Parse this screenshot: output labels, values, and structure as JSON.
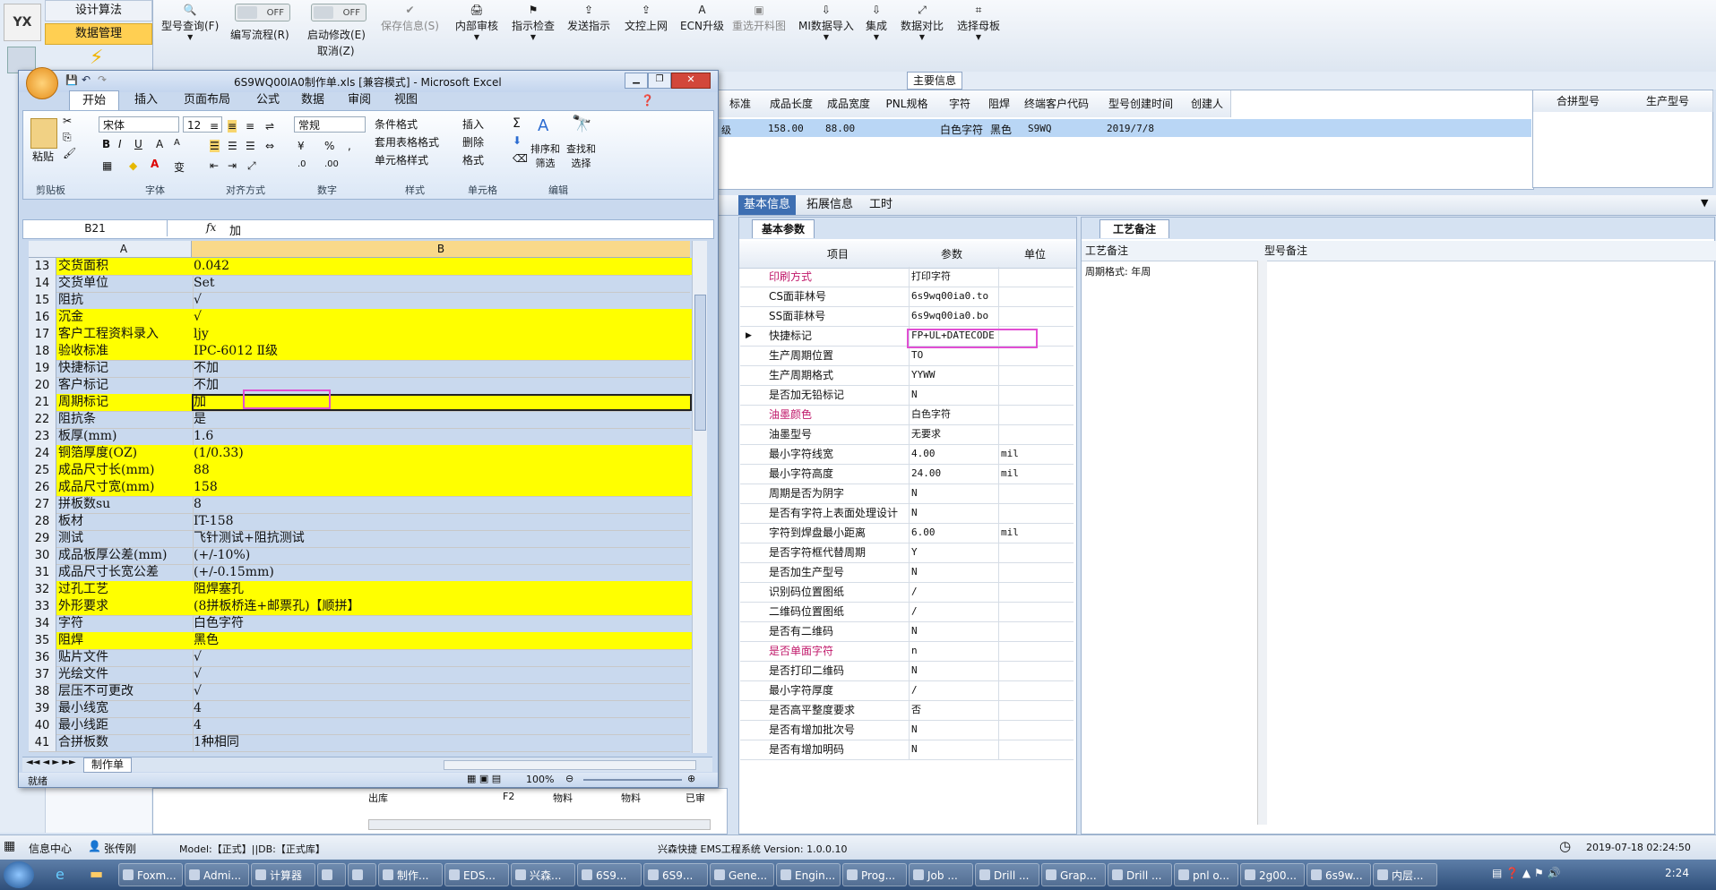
{
  "app": {
    "nav_tabs": [
      "设计算法",
      "数据管理"
    ],
    "toolbar": [
      {
        "label": "型号查询(F)",
        "icon": "search-icon",
        "disabled": false
      },
      {
        "label": "编写流程(R)",
        "icon": "toggle",
        "disabled": false
      },
      {
        "label": "启动修改(E)",
        "icon": "toggle",
        "disabled": false
      },
      {
        "label": "取消(Z)",
        "icon": "",
        "disabled": false
      },
      {
        "label": "保存信息(S)",
        "icon": "check-icon",
        "disabled": true
      },
      {
        "label": "内部审核",
        "icon": "print-icon",
        "disabled": false
      },
      {
        "label": "指示检查",
        "icon": "flag-icon",
        "disabled": false
      },
      {
        "label": "发送指示",
        "icon": "upload-icon",
        "disabled": false
      },
      {
        "label": "文控上网",
        "icon": "upload-icon",
        "disabled": false
      },
      {
        "label": "ECN升级",
        "icon": "letter-a-icon",
        "disabled": false
      },
      {
        "label": "重选开料图",
        "icon": "image-icon",
        "disabled": true
      },
      {
        "label": "MI数据导入",
        "icon": "download-icon",
        "disabled": false
      },
      {
        "label": "集成",
        "icon": "download-icon",
        "disabled": false
      },
      {
        "label": "数据对比",
        "icon": "compare-icon",
        "disabled": false
      },
      {
        "label": "选择母板",
        "icon": "grid-icon",
        "disabled": false
      }
    ],
    "toggle_off": "OFF",
    "main_info_title": "主要信息",
    "main_columns": [
      "标准",
      "成品长度",
      "成品宽度",
      "PNL规格",
      "字符",
      "阻焊",
      "终端客户代码",
      "型号创建时间",
      "创建人"
    ],
    "main_row": [
      "级",
      "158.00",
      "88.00",
      "",
      "白色字符",
      "黑色",
      "S9WQ",
      "2019/7/8",
      ""
    ],
    "right_columns": [
      "合拼型号",
      "生产型号"
    ],
    "detail_tabs": [
      "基本信息",
      "拓展信息",
      "工时"
    ],
    "basic_params_tab": "基本参数",
    "process_notes_tab": "工艺备注",
    "param_headers": [
      "项目",
      "参数",
      "单位"
    ],
    "params": [
      {
        "k": "印刷方式",
        "v": "打印字符",
        "u": "",
        "red": true
      },
      {
        "k": "CS面菲林号",
        "v": "6s9wq00ia0.to",
        "u": "",
        "red": false
      },
      {
        "k": "SS面菲林号",
        "v": "6s9wq00ia0.bo",
        "u": "",
        "red": false
      },
      {
        "k": "快捷标记",
        "v": "FP+UL+DATECODE",
        "u": "",
        "red": false
      },
      {
        "k": "生产周期位置",
        "v": "TO",
        "u": "",
        "red": false
      },
      {
        "k": "生产周期格式",
        "v": "YYWW",
        "u": "",
        "red": false
      },
      {
        "k": "是否加无铅标记",
        "v": "N",
        "u": "",
        "red": false
      },
      {
        "k": "油墨颜色",
        "v": "白色字符",
        "u": "",
        "red": true
      },
      {
        "k": "油墨型号",
        "v": "无要求",
        "u": "",
        "red": false
      },
      {
        "k": "最小字符线宽",
        "v": "4.00",
        "u": "mil",
        "red": false
      },
      {
        "k": "最小字符高度",
        "v": "24.00",
        "u": "mil",
        "red": false
      },
      {
        "k": "周期是否为阴字",
        "v": "N",
        "u": "",
        "red": false
      },
      {
        "k": "是否有字符上表面处理设计",
        "v": "N",
        "u": "",
        "red": false
      },
      {
        "k": "字符到焊盘最小距离",
        "v": "6.00",
        "u": "mil",
        "red": false
      },
      {
        "k": "是否字符框代替周期",
        "v": "Y",
        "u": "",
        "red": false
      },
      {
        "k": "是否加生产型号",
        "v": "N",
        "u": "",
        "red": false
      },
      {
        "k": "识别码位置图纸",
        "v": "/",
        "u": "",
        "red": false
      },
      {
        "k": "二维码位置图纸",
        "v": "/",
        "u": "",
        "red": false
      },
      {
        "k": "是否有二维码",
        "v": "N",
        "u": "",
        "red": false
      },
      {
        "k": "是否单面字符",
        "v": "n",
        "u": "",
        "red": true
      },
      {
        "k": "是否打印二维码",
        "v": "N",
        "u": "",
        "red": false
      },
      {
        "k": "最小字符厚度",
        "v": "/",
        "u": "",
        "red": false
      },
      {
        "k": "是否高平整度要求",
        "v": "否",
        "u": "",
        "red": false
      },
      {
        "k": "是否有增加批次号",
        "v": "N",
        "u": "",
        "red": false
      },
      {
        "k": "是否有增加明码",
        "v": "N",
        "u": "",
        "red": false
      }
    ],
    "notes_headers": [
      "工艺备注",
      "型号备注"
    ],
    "notes_value": "周期格式: 年周",
    "behind_row": [
      "出库",
      "F2",
      "物料",
      "物料",
      "已审"
    ],
    "status_bar": {
      "info_center": "信息中心",
      "user": "张传刚",
      "model": "Model:【正式】||DB:【正式库】",
      "system": "兴森快捷 EMS工程系统  Version: 1.0.0.10",
      "datetime": "2019-07-18 02:24:50"
    }
  },
  "excel": {
    "title": "6S9WQ00IA0制作单.xls  [兼容模式] - Microsoft Excel",
    "tabs": [
      "开始",
      "插入",
      "页面布局",
      "公式",
      "数据",
      "审阅",
      "视图"
    ],
    "font_name": "宋体",
    "font_size": "12",
    "number_format": "常规",
    "groups": [
      "剪贴板",
      "字体",
      "对齐方式",
      "数字",
      "样式",
      "单元格",
      "编辑"
    ],
    "paste_label": "粘贴",
    "style_items": [
      "条件格式",
      "套用表格格式",
      "单元格样式"
    ],
    "cell_items": [
      "插入",
      "删除",
      "格式"
    ],
    "edit_items": [
      "排序和\n筛选",
      "查找和\n选择"
    ],
    "name_box": "B21",
    "formula": "加",
    "col_a": "A",
    "col_b": "B",
    "rows": [
      {
        "n": "13",
        "a": "交货面积",
        "b": "0.042",
        "y": true
      },
      {
        "n": "14",
        "a": "交货单位",
        "b": "Set",
        "y": false
      },
      {
        "n": "15",
        "a": "阻抗",
        "b": "√",
        "y": false
      },
      {
        "n": "16",
        "a": "沉金",
        "b": "√",
        "y": true
      },
      {
        "n": "17",
        "a": "客户工程资料录入",
        "b": "ljy",
        "y": true
      },
      {
        "n": "18",
        "a": "验收标准",
        "b": "IPC-6012 Ⅱ级",
        "y": true
      },
      {
        "n": "19",
        "a": "快捷标记",
        "b": "不加",
        "y": false
      },
      {
        "n": "20",
        "a": "客户标记",
        "b": "不加",
        "y": false
      },
      {
        "n": "21",
        "a": "周期标记",
        "b": "加",
        "y": true
      },
      {
        "n": "22",
        "a": "阻抗条",
        "b": "是",
        "y": false
      },
      {
        "n": "23",
        "a": "板厚(mm)",
        "b": "1.6",
        "y": false
      },
      {
        "n": "24",
        "a": "铜箔厚度(OZ)",
        "b": " (1/0.33)",
        "y": true
      },
      {
        "n": "25",
        "a": "成品尺寸长(mm)",
        "b": "88",
        "y": true
      },
      {
        "n": "26",
        "a": "成品尺寸宽(mm)",
        "b": "158",
        "y": true
      },
      {
        "n": "27",
        "a": "拼板数su",
        "b": "8",
        "y": false
      },
      {
        "n": "28",
        "a": "板材",
        "b": "IT-158",
        "y": false
      },
      {
        "n": "29",
        "a": "测试",
        "b": "飞针测试+阻抗测试",
        "y": false
      },
      {
        "n": "30",
        "a": "成品板厚公差(mm)",
        "b": "(+/-10%)",
        "y": false
      },
      {
        "n": "31",
        "a": "成品尺寸长宽公差",
        "b": "(+/-0.15mm)",
        "y": false
      },
      {
        "n": "32",
        "a": "过孔工艺",
        "b": "阻焊塞孔",
        "y": true
      },
      {
        "n": "33",
        "a": "外形要求",
        "b": "(8拼板桥连+邮票孔)【顺拼】",
        "y": true
      },
      {
        "n": "34",
        "a": "字符",
        "b": "白色字符",
        "y": false
      },
      {
        "n": "35",
        "a": "阻焊",
        "b": "黑色",
        "y": true
      },
      {
        "n": "36",
        "a": "贴片文件",
        "b": "√",
        "y": false
      },
      {
        "n": "37",
        "a": "光绘文件",
        "b": "√",
        "y": false
      },
      {
        "n": "38",
        "a": "层压不可更改",
        "b": "√",
        "y": false
      },
      {
        "n": "39",
        "a": "最小线宽",
        "b": "4",
        "y": false
      },
      {
        "n": "40",
        "a": "最小线距",
        "b": "4",
        "y": false
      },
      {
        "n": "41",
        "a": "合拼板数",
        "b": "1种相同",
        "y": false
      }
    ],
    "sheet_tab": "制作单",
    "status": "就绪",
    "zoom": "100%"
  },
  "taskbar": [
    "Foxm...",
    "Admi...",
    "计算器",
    "",
    "",
    "制作...",
    "EDS...",
    "兴森...",
    "6S9...",
    "6S9...",
    "Gene...",
    "Engin...",
    "Prog...",
    "Job ...",
    "Drill ...",
    "Grap...",
    "Drill ...",
    "pnl o...",
    "2g00...",
    "6s9w...",
    "内层..."
  ],
  "clock": "2:24"
}
